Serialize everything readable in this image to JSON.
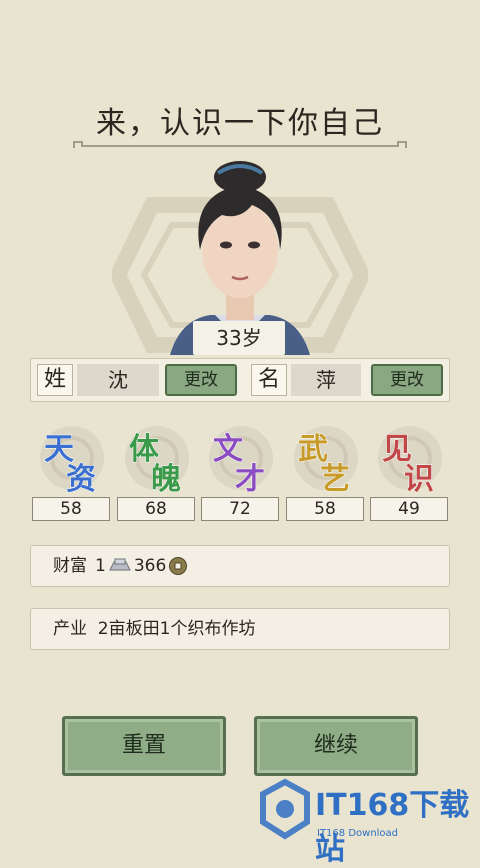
{
  "header": {
    "title": "来，认识一下你自己"
  },
  "character": {
    "age_label": "33岁"
  },
  "name_bar": {
    "surname_label": "姓",
    "surname_value": "沈",
    "surname_change": "更改",
    "given_label": "名",
    "given_value": "萍",
    "given_change": "更改"
  },
  "attributes": [
    {
      "char1": "天",
      "char2": "资",
      "value": "58",
      "color": "#3a6fd0"
    },
    {
      "char1": "体",
      "char2": "魄",
      "value": "68",
      "color": "#3a9a4a"
    },
    {
      "char1": "文",
      "char2": "才",
      "value": "72",
      "color": "#8a4cc0"
    },
    {
      "char1": "武",
      "char2": "艺",
      "value": "58",
      "color": "#c89a2a"
    },
    {
      "char1": "见",
      "char2": "识",
      "value": "49",
      "color": "#c04848"
    }
  ],
  "wealth": {
    "label": "财富",
    "silver": "1",
    "coins": "366"
  },
  "property": {
    "text": "产业  2亩板田1个织布作坊"
  },
  "buttons": {
    "reset": "重置",
    "continue": "继续"
  },
  "watermark": {
    "brand": "IT168下载站",
    "sub": "IT168 Download"
  }
}
